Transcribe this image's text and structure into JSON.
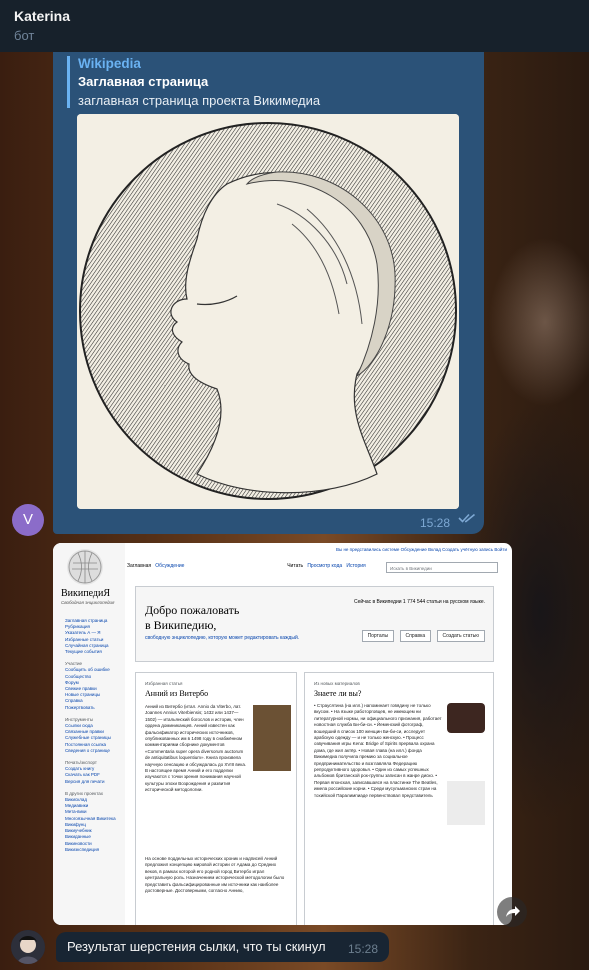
{
  "header": {
    "name": "Katerina",
    "status": "бот"
  },
  "preview": {
    "site": "Wikipedia",
    "title": "Заглавная страница",
    "description": "заглавная страница проекта Викимедиа",
    "time": "15:28"
  },
  "sender_avatar_letter": "V",
  "message": {
    "text": "Результат шерстения сылки, что ты скинул",
    "time": "15:28"
  },
  "wiki": {
    "logo_text": "ВикипедиЯ",
    "logo_sub": "Свободная энциклопедия",
    "sidebar_items": [
      "Заглавная страница",
      "Рубрикация",
      "Указатель А — Я",
      "Избранные статьи",
      "Случайная страница",
      "Текущие события"
    ],
    "sidebar_section_participation": "Участие",
    "sidebar_items2": [
      "Сообщить об ошибке",
      "Сообщество",
      "Форум",
      "Свежие правки",
      "Новые страницы",
      "Справка",
      "Пожертвовать"
    ],
    "sidebar_section_tools": "Инструменты",
    "sidebar_items3": [
      "Ссылки сюда",
      "Связанные правки",
      "Служебные страницы",
      "Постоянная ссылка",
      "Сведения о странице"
    ],
    "sidebar_section_print": "Печать/экспорт",
    "sidebar_items4": [
      "Создать книгу",
      "Скачать как PDF",
      "Версия для печати"
    ],
    "sidebar_section_projects": "В других проектах",
    "sidebar_items5": [
      "Викисклад",
      "Медиавики",
      "Мета-вики",
      "Многоязычная Викитека",
      "Викифунц",
      "Викиучебник",
      "Викиданные",
      "Викиновости",
      "Викиэкспедиция"
    ],
    "user_links": "Вы не представились системе  Обсуждение  Вклад  Создать учётную запись  Войти",
    "tab_main": "Заглавная",
    "tab_talk": "Обсуждение",
    "tab_read": "Читать",
    "tab_view_source": "Просмотр кода",
    "tab_history": "История",
    "search_placeholder": "Искать в Википедии",
    "welcome_line1": "Добро пожаловать",
    "welcome_line2": "в Википедию,",
    "welcome_line3": "свободную энциклопедию, которую может редактировать каждый.",
    "article_count": "Сейчас в Википедии 1 774 544 статьи на русском языке.",
    "btn_portals": "Порталы",
    "btn_help": "Справка",
    "btn_create": "Создать статью",
    "featured_label": "Избранная статья",
    "featured_title": "Анний из Витербо",
    "featured_text": "Анний из Витербо (итал. Annio da Viterbo, лат. Joannes Annius Viterbiensis; 1432 или 1437—1502) — итальянский богослов и историк, член ордена доминиканцев. Анний известен как фальсификатор исторических источников, опубликованных им в 1498 году в снабжённом комментариями сборнике документов «Commentaria super opera diversorum auctorum de antiquitatibus loquentium». Книга произвела научную сенсацию и обсуждалась до XVIII века. В настоящее время Анний и его подделки изучаются с точки зрения понимания научной культуры эпохи Возрождения и развития исторической методологии.",
    "featured_text2": "На основе поддельных исторических хроник и надписей Анний предложил концепцию мировой истории от Адама до Средних веков, в рамках которой его родной город Витербо играл центральную роль. Назначением исторической методологии было представить фальсифицированные им источники как наиболее достоверные. Достоверными, согласно Аннию,",
    "dyk_label": "Из новых материалов",
    "dyk_title": "Знаете ли вы?",
    "dyk_text": "• Страусятина (на илл.) напоминает говядину не только вкусом. • На языке работорговцев, не имеющем ни литературной нормы, ни официального признания, работает новостная служба Би-би-си. • Йеменский фотограф, вошедший в список 100 женщин Би-би-си, исследует арабскую одежду — и не только женскую. • Процесс озвучивания игры Kena: Bridge of Spirits прервала охрана дома, где жил актёр. • Новая глава (на илл.) фонда Викимедиа получила премию за социальное предпринимательство и возглавляла Федерацию репродуктивного здоровья. • Один из самых успешных альбомов британской рок-группы записан в жанре диско. • Первая японская, записавшаяся на пластинке The Beatles, имела российские корни. • Среди мусульманских стран на тохийской Паралимпиаде первенствовал представитель"
  }
}
